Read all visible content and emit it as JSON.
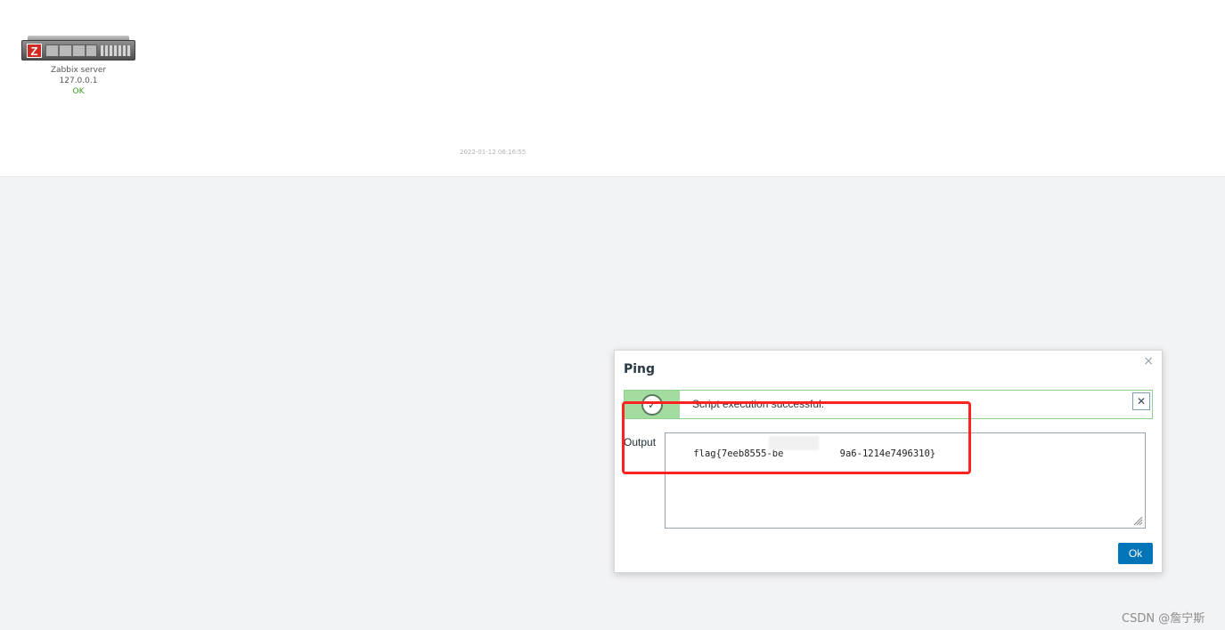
{
  "map": {
    "host": {
      "name": "Zabbix server",
      "ip": "127.0.0.1",
      "status": "OK",
      "icon": "server-icon",
      "badge_letter": "Z"
    },
    "timestamp": "2022-01-12 06:16:55"
  },
  "dialog": {
    "title": "Ping",
    "message": "Script execution successful.",
    "output_label": "Output",
    "output_value": "flag{7eeb8555-be          9a6-1214e7496310}",
    "ok_label": "Ok",
    "colors": {
      "success_border": "#8cd38c",
      "success_strip": "#a2dca0",
      "primary_button": "#0275b8",
      "annotation": "#ff2222"
    }
  },
  "watermark": "CSDN @詹宁斯"
}
